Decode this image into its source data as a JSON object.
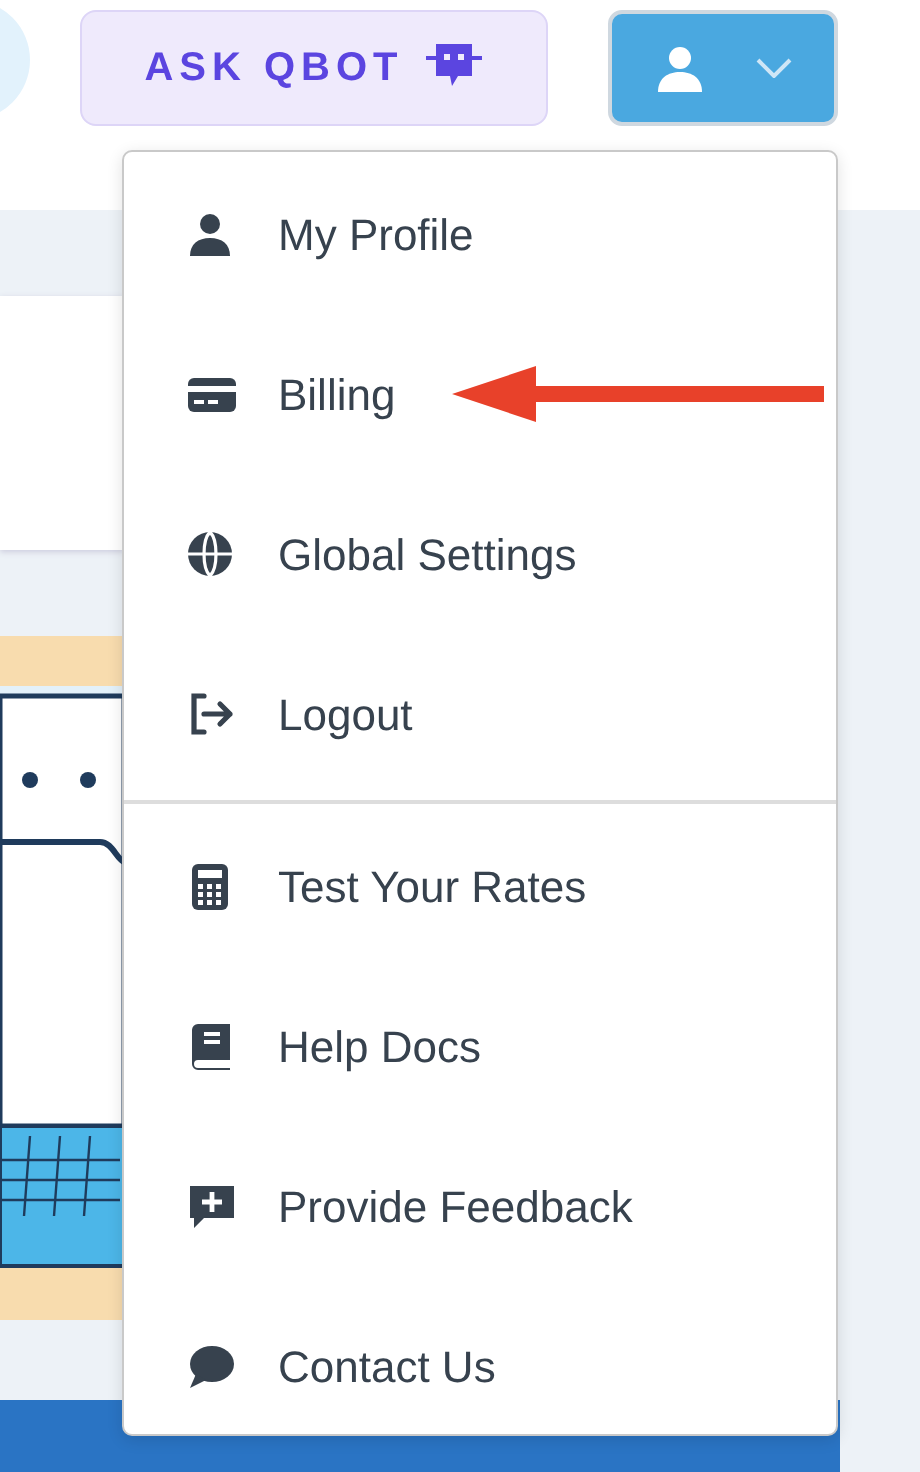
{
  "header": {
    "ask_button": "ASK QBOT"
  },
  "menu": {
    "groups": [
      [
        {
          "label": "My Profile"
        },
        {
          "label": "Billing"
        },
        {
          "label": "Global Settings"
        },
        {
          "label": "Logout"
        }
      ],
      [
        {
          "label": "Test Your Rates"
        },
        {
          "label": "Help Docs"
        },
        {
          "label": "Provide Feedback"
        },
        {
          "label": "Contact Us"
        }
      ]
    ]
  }
}
